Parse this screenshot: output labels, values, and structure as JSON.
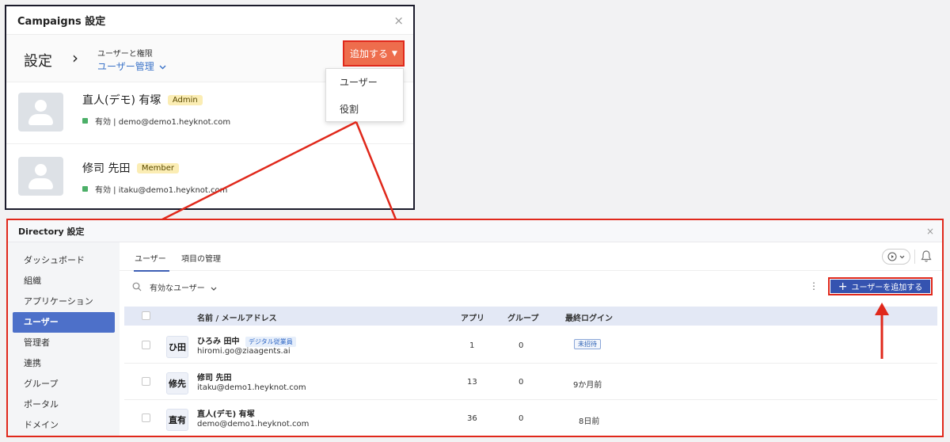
{
  "campaigns": {
    "title": "Campaigns 設定",
    "close": "×",
    "settings_label": "設定",
    "breadcrumb_chevron": "›",
    "role_section_label": "ユーザーと権限",
    "role_select": "ユーザー管理",
    "add_button": "追加する",
    "dropdown": [
      "ユーザー",
      "役割"
    ],
    "users": [
      {
        "name": "直人(デモ) 有塚",
        "role": "Admin",
        "status": "有効 | demo@demo1.heyknot.com"
      },
      {
        "name": "修司 先田",
        "role": "Member",
        "status": "有効 | itaku@demo1.heyknot.com"
      }
    ]
  },
  "directory": {
    "title": "Directory 設定",
    "close": "×",
    "sidebar": [
      "ダッシュボード",
      "組織",
      "アプリケーション",
      "ユーザー",
      "管理者",
      "連携",
      "グループ",
      "ポータル",
      "ドメイン"
    ],
    "tabs": [
      "ユーザー",
      "項目の管理"
    ],
    "filter": "有効なユーザー",
    "add_user_button": "ユーザーを追加する",
    "columns": {
      "name": "名前 / メールアドレス",
      "apps": "アプリ",
      "groups": "グループ",
      "last_login": "最終ログイン"
    },
    "rows": [
      {
        "initials": "ひ田",
        "name": "ひろみ 田中",
        "badge": "デジタル従業員",
        "email": "hiromi.go@ziaagents.ai",
        "apps": "1",
        "groups": "0",
        "last_login": "未招待"
      },
      {
        "initials": "修先",
        "name": "修司 先田",
        "badge": "",
        "email": "itaku@demo1.heyknot.com",
        "apps": "13",
        "groups": "0",
        "last_login": "9か月前"
      },
      {
        "initials": "直有",
        "name": "直人(デモ) 有塚",
        "badge": "",
        "email": "demo@demo1.heyknot.com",
        "apps": "36",
        "groups": "0",
        "last_login": "8日前"
      }
    ]
  },
  "colors": {
    "highlight": "#e0281b",
    "accent_blue": "#3553b0",
    "add_orange": "#ee6d4d",
    "status_green": "#4caf68"
  },
  "icons": [
    "close-icon",
    "chevron-right-icon",
    "chevron-down-icon",
    "user-avatar-icon",
    "search-icon",
    "kebab-menu-icon",
    "plus-icon",
    "media-play-icon",
    "bell-icon",
    "checkbox-icon"
  ]
}
